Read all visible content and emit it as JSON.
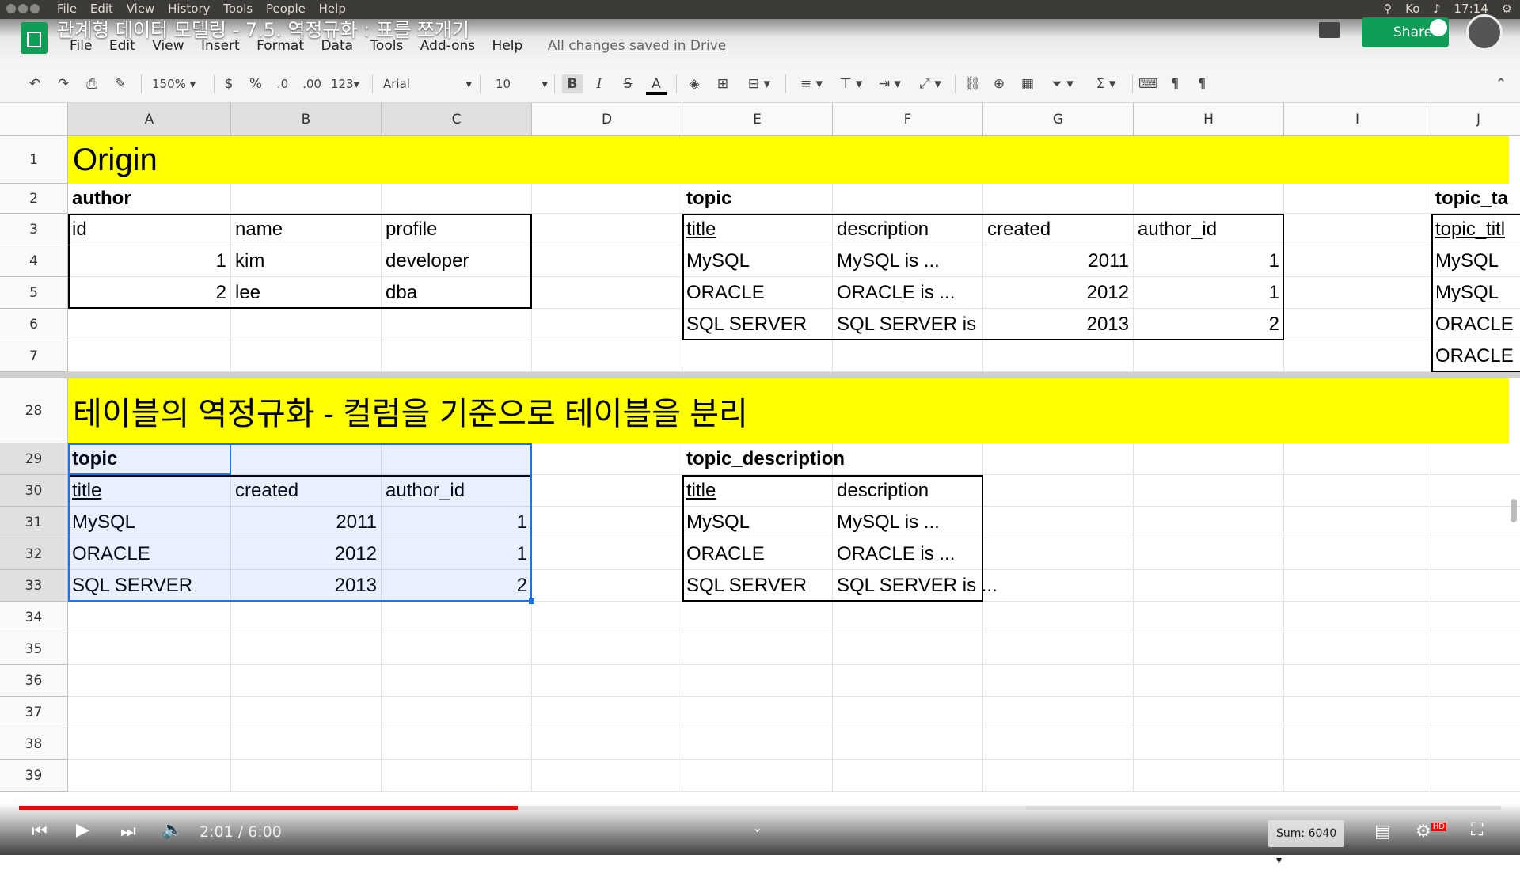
{
  "system_bar": {
    "menu": [
      "File",
      "Edit",
      "View",
      "History",
      "Tools",
      "People",
      "Help"
    ],
    "clock": "17:14",
    "kb": "Ko"
  },
  "doc": {
    "title": "관계형 데이터 모델링 - 7.5. 역정규화 : 표를 쪼개기",
    "menu": [
      "File",
      "Edit",
      "View",
      "Insert",
      "Format",
      "Data",
      "Tools",
      "Add-ons",
      "Help"
    ],
    "saved": "All changes saved in Drive",
    "share": "Share"
  },
  "toolbar": {
    "zoom": "150%",
    "currency": "$",
    "percent": "%",
    "dec_less": ".0",
    "dec_more": ".00",
    "format": "123",
    "font": "Arial",
    "size": "10",
    "bold": "B",
    "italic": "I",
    "strike": "S",
    "textcolor": "A"
  },
  "grid": {
    "columns": [
      "A",
      "B",
      "C",
      "D",
      "E",
      "F",
      "G",
      "H",
      "I",
      "J"
    ],
    "rows": [
      "1",
      "2",
      "3",
      "4",
      "5",
      "6",
      "7",
      "28",
      "29",
      "30",
      "31",
      "32",
      "33",
      "34",
      "35",
      "36",
      "37",
      "38",
      "39"
    ],
    "origin_title": "Origin",
    "section_title": "테이블의 역정규화 - 컬럼을 기준으로 테이블을 분리",
    "author": {
      "label": "author",
      "headers": [
        "id",
        "name",
        "profile"
      ],
      "rows": [
        [
          "1",
          "kim",
          "developer"
        ],
        [
          "2",
          "lee",
          "dba"
        ]
      ]
    },
    "topic": {
      "label": "topic",
      "headers": [
        "title",
        "description",
        "created",
        "author_id"
      ],
      "rows": [
        [
          "MySQL",
          "MySQL is ...",
          "2011",
          "1"
        ],
        [
          "ORACLE",
          "ORACLE is ...",
          "2012",
          "1"
        ],
        [
          "SQL SERVER",
          "SQL SERVER is",
          "2013",
          "2"
        ]
      ]
    },
    "topic_tag": {
      "label": "topic_ta",
      "header": "topic_titl",
      "rows": [
        "MySQL",
        "MySQL",
        "ORACLE",
        "ORACLE"
      ]
    },
    "topic_split": {
      "label": "topic",
      "headers": [
        "title",
        "created",
        "author_id"
      ],
      "rows": [
        [
          "MySQL",
          "2011",
          "1"
        ],
        [
          "ORACLE",
          "2012",
          "1"
        ],
        [
          "SQL SERVER",
          "2013",
          "2"
        ]
      ]
    },
    "topic_description": {
      "label": "topic_description",
      "headers": [
        "title",
        "description"
      ],
      "rows": [
        [
          "MySQL",
          "MySQL is ..."
        ],
        [
          "ORACLE",
          "ORACLE is ..."
        ],
        [
          "SQL SERVER",
          "SQL SERVER is ..."
        ]
      ]
    }
  },
  "player": {
    "time": "2:01 / 6:00",
    "sum": "Sum: 6040",
    "hd": "HD"
  },
  "colors": {
    "highlight": "#ffff00",
    "selection": "#1a73e8",
    "progress": "#ff0000",
    "brand": "#0f9d58"
  }
}
